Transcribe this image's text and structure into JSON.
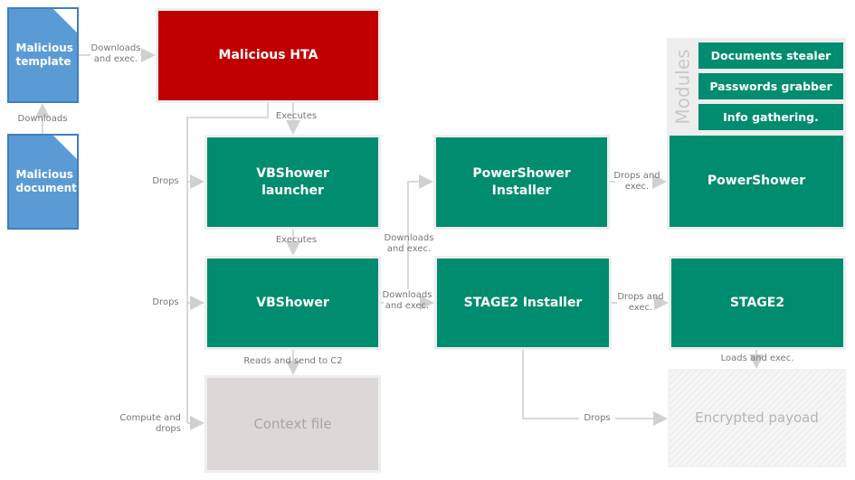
{
  "nodes": {
    "malicious_template": "Malicious template",
    "malicious_document": "Malicious document",
    "malicious_hta": "Malicious HTA",
    "vbshower_launcher": "VBShower launcher",
    "vbshower": "VBShower",
    "powershower_installer": "PowerShower Installer",
    "stage2_installer": "STAGE2 Installer",
    "powershower": "PowerShower",
    "stage2": "STAGE2",
    "context_file": "Context file",
    "encrypted_payload": "Encrypted payoad"
  },
  "modules": {
    "label": "Modules",
    "items": [
      "Documents stealer",
      "Passwords grabber",
      "Info gathering."
    ]
  },
  "edges": {
    "doc_to_template": "Downloads",
    "template_to_hta": "Downloads and exec.",
    "hta_to_launcher": "Executes",
    "drops_launcher": "Drops",
    "launcher_to_vbshower": "Executes",
    "drops_vbshower": "Drops",
    "vbshower_to_psinstaller": "Downloads and exec.",
    "vbshower_to_s2installer": "Downloads and exec.",
    "psinstaller_to_powershower": "Drops and exec.",
    "s2installer_to_stage2": "Drops and exec.",
    "vbshower_to_context": "Reads and send to C2",
    "compute_and_drops": "Compute and drops",
    "s2installer_to_payload": "Drops",
    "stage2_to_payload": "Loads and exec."
  },
  "colors": {
    "red": "#c00000",
    "green": "#008c6e",
    "blue": "#5b9bd5",
    "gray": "#dcd8d8"
  }
}
